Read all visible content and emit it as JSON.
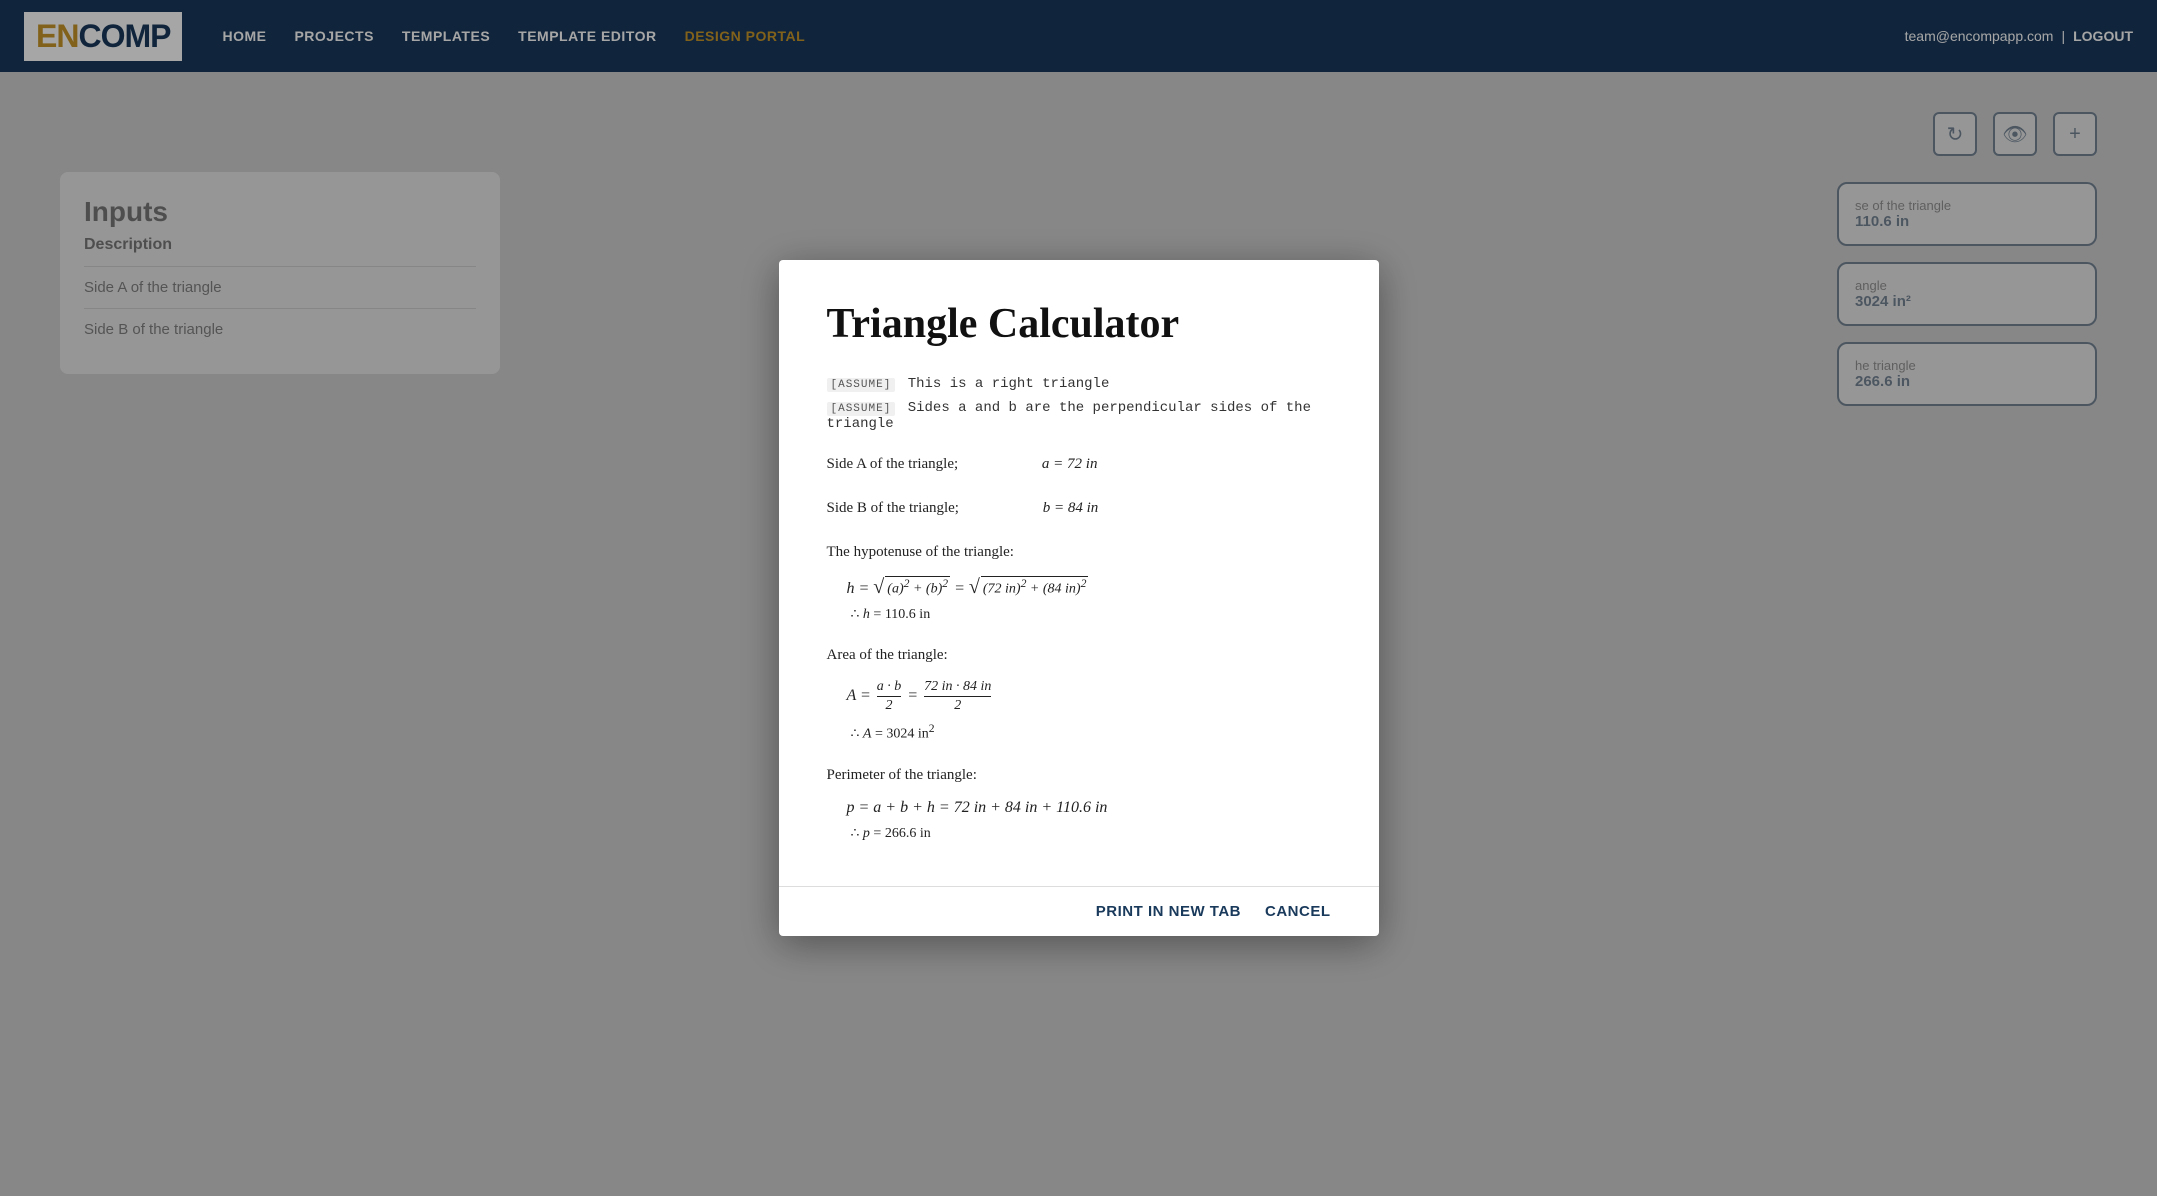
{
  "nav": {
    "logo_en": "EN",
    "logo_comp": "COMP",
    "links": [
      {
        "label": "HOME",
        "active": false
      },
      {
        "label": "PROJECTS",
        "active": false
      },
      {
        "label": "TEMPLATES",
        "active": false
      },
      {
        "label": "TEMPLATE EDITOR",
        "active": false
      },
      {
        "label": "DESIGN PORTAL",
        "active": true
      }
    ],
    "user_email": "team@encompapp.com",
    "logout_label": "LOGOUT"
  },
  "background": {
    "inputs_title": "Inputs",
    "inputs_description": "Description",
    "rows": [
      {
        "label": "Side A of the triangle"
      },
      {
        "label": "Side B of the triangle"
      }
    ],
    "output_cards": [
      {
        "label": "se of the triangle",
        "value": "110.6 in"
      },
      {
        "label": "angle",
        "value": "3024 in²"
      },
      {
        "label": "he triangle",
        "value": "266.6 in"
      }
    ]
  },
  "modal": {
    "title": "Triangle Calculator",
    "assume1": "[ASSUME]  This is a right triangle",
    "assume2": "[ASSUME]  Sides a and b are the perpendicular sides of the triangle",
    "side_a_label": "Side A of the triangle;",
    "side_a_value": "a = 72 in",
    "side_b_label": "Side B of the triangle;",
    "side_b_value": "b = 84 in",
    "hypotenuse_title": "The hypotenuse of the triangle:",
    "hyp_formula_display": "h = √((a)² + (b)²) = √((72 in)² + (84 in)²)",
    "hyp_therefore": "∴ h = 110.6 in",
    "area_title": "Area of the triangle:",
    "area_formula_display": "A = (a · b) / 2 = (72 in · 84 in) / 2",
    "area_therefore": "∴ A = 3024 in²",
    "perimeter_title": "Perimeter of the triangle:",
    "perimeter_formula": "p = a + b + h = 72 in + 84 in + 110.6 in",
    "perimeter_therefore": "∴ p = 266.6 in",
    "print_label": "PRINT IN NEW TAB",
    "cancel_label": "CANCEL"
  }
}
